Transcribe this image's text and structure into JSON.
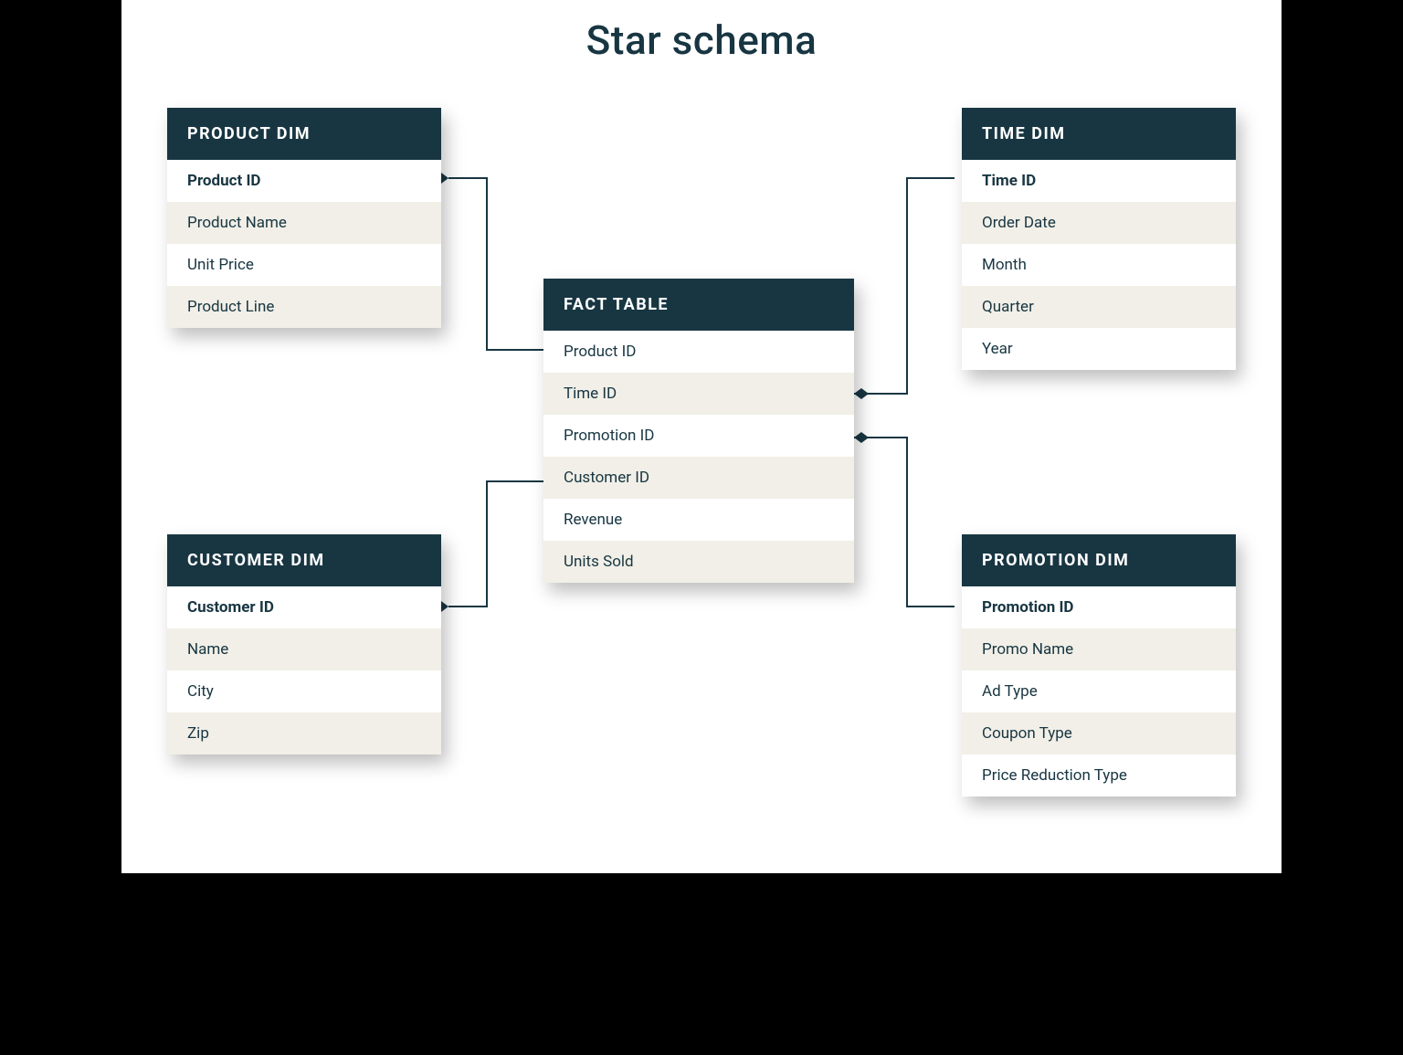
{
  "title": "Star schema",
  "tables": {
    "product": {
      "header": "PRODUCT DIM",
      "rows": [
        "Product ID",
        "Product Name",
        "Unit Price",
        "Product Line"
      ]
    },
    "time": {
      "header": "TIME DIM",
      "rows": [
        "Time ID",
        "Order Date",
        "Month",
        "Quarter",
        "Year"
      ]
    },
    "fact": {
      "header": "FACT TABLE",
      "rows": [
        "Product ID",
        "Time ID",
        "Promotion ID",
        "Customer ID",
        "Revenue",
        "Units Sold"
      ]
    },
    "customer": {
      "header": "CUSTOMER DIM",
      "rows": [
        "Customer ID",
        "Name",
        "City",
        "Zip"
      ]
    },
    "promotion": {
      "header": "PROMOTION DIM",
      "rows": [
        "Promotion ID",
        "Promo Name",
        "Ad Type",
        "Coupon Type",
        "Price Reduction Type"
      ]
    }
  }
}
